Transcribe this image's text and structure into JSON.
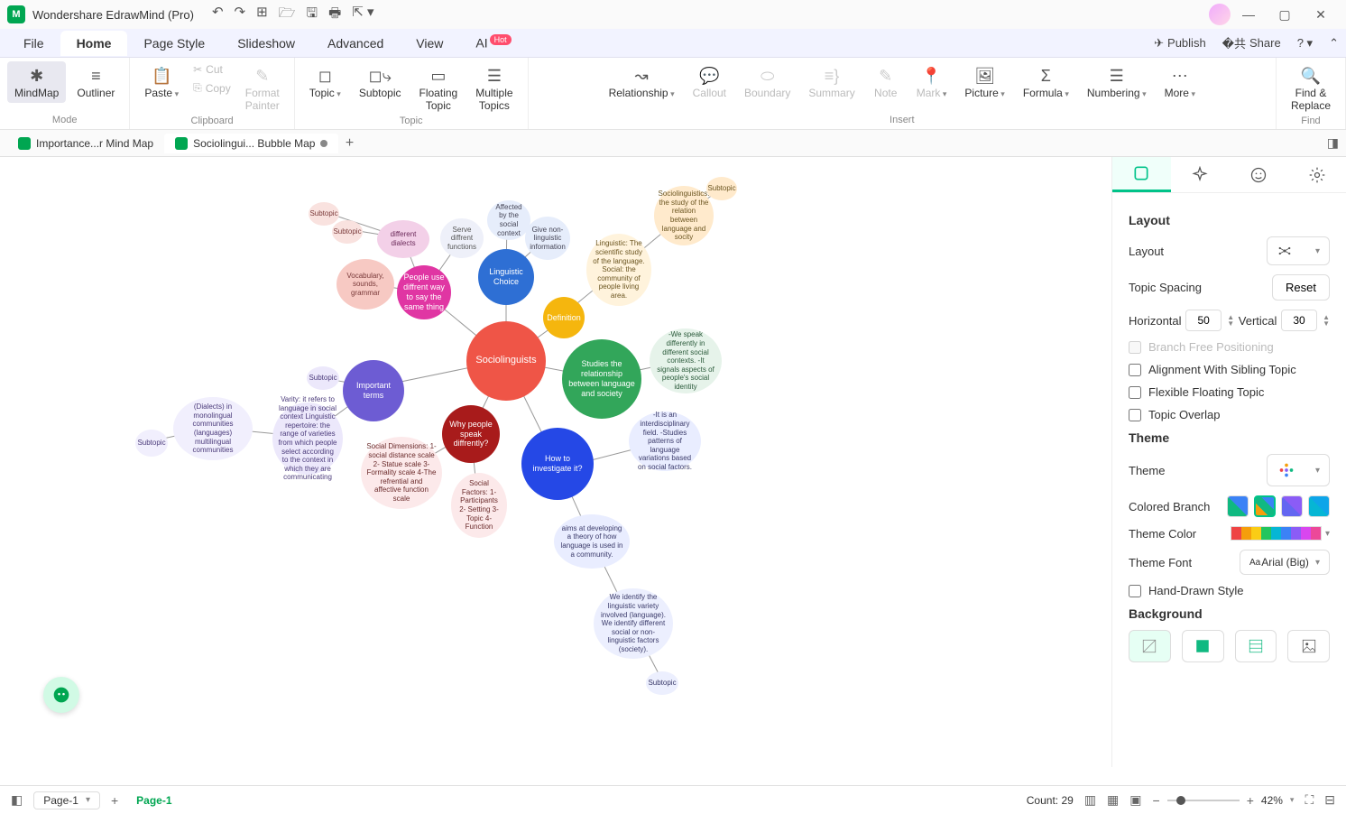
{
  "app": {
    "title": "Wondershare EdrawMind (Pro)"
  },
  "menu": {
    "tabs": [
      "File",
      "Home",
      "Page Style",
      "Slideshow",
      "Advanced",
      "View",
      "AI"
    ],
    "active": 1,
    "publish": "Publish",
    "share": "Share"
  },
  "ribbon": {
    "mode": {
      "label": "Mode",
      "mindmap": "MindMap",
      "outliner": "Outliner"
    },
    "clipboard": {
      "label": "Clipboard",
      "paste": "Paste",
      "cut": "Cut",
      "copy": "Copy",
      "painter1": "Format",
      "painter2": "Painter"
    },
    "topic": {
      "label": "Topic",
      "topic": "Topic",
      "subtopic": "Subtopic",
      "floating1": "Floating",
      "floating2": "Topic",
      "multi1": "Multiple",
      "multi2": "Topics"
    },
    "insert": {
      "label": "Insert",
      "relationship": "Relationship",
      "callout": "Callout",
      "boundary": "Boundary",
      "summary": "Summary",
      "note": "Note",
      "mark": "Mark",
      "picture": "Picture",
      "formula": "Formula",
      "numbering": "Numbering",
      "more": "More"
    },
    "find": {
      "label": "Find",
      "find1": "Find &",
      "find2": "Replace"
    }
  },
  "docs": {
    "tab1": "Importance...r Mind Map",
    "tab2": "Sociolingui... Bubble Map"
  },
  "bubbles": {
    "center": "Sociolinguists",
    "def": "Definition",
    "ling_choice": "Linguistic Choice",
    "important": "Important terms",
    "why": "Why people speak diffrently?",
    "how": "How to investigate it?",
    "relation": "Studies the relationship between language and society",
    "people_use": "People use diffrent way to say the same thing",
    "vocab": "Vocabulary, sounds, grammar",
    "diff_dialects": "different dialects",
    "serve_func": "Serve diffrent functions",
    "affected": "Affected by the social context",
    "give_info": "Give non-linguistic information",
    "ling_soc": "Linguistic: The scientific study of the language. Social: the community of people living area.",
    "socio_def": "Sociolinguistics: the study of the relation between language and socity",
    "speak_diff": "-We speak differently in different social contexts. -It signals aspects of people's social identity",
    "inter": "-It is an interdisciplinary field. -Studies patterns of language variations based on social factors.",
    "aims": "aims at developing a theory of how language is used in a community.",
    "identify": "We identify the linguistic variety involved (language). We identify different social or non-linguistic factors (society).",
    "social_dim": "Social Dimensions: 1-social distance scale 2- Statue scale 3- Formality scale 4-The refrential and affective function scale",
    "social_fac": "Social Factors: 1- Participants 2- Setting 3- Topic 4- Function",
    "varity": "Varity: it refers to language in social context Linguistic repertoire: the range of varieties from which people select according to the context in which they are communicating",
    "dialects": "(Dialects) in monolingual communities (languages) multilingual communities",
    "subtopic": "Subtopic"
  },
  "panel": {
    "layout_h": "Layout",
    "layout": "Layout",
    "spacing": "Topic Spacing",
    "reset": "Reset",
    "horizontal": "Horizontal",
    "h_val": "50",
    "vertical": "Vertical",
    "v_val": "30",
    "branch_free": "Branch Free Positioning",
    "align_sib": "Alignment With Sibling Topic",
    "flex_float": "Flexible Floating Topic",
    "overlap": "Topic Overlap",
    "theme_h": "Theme",
    "theme": "Theme",
    "colored_branch": "Colored Branch",
    "theme_color": "Theme Color",
    "theme_font": "Theme Font",
    "font_val": "Arial (Big)",
    "hand_drawn": "Hand-Drawn Style",
    "background_h": "Background"
  },
  "status": {
    "page_sel": "Page-1",
    "page_tab": "Page-1",
    "count": "Count: 29",
    "zoom": "42%"
  }
}
